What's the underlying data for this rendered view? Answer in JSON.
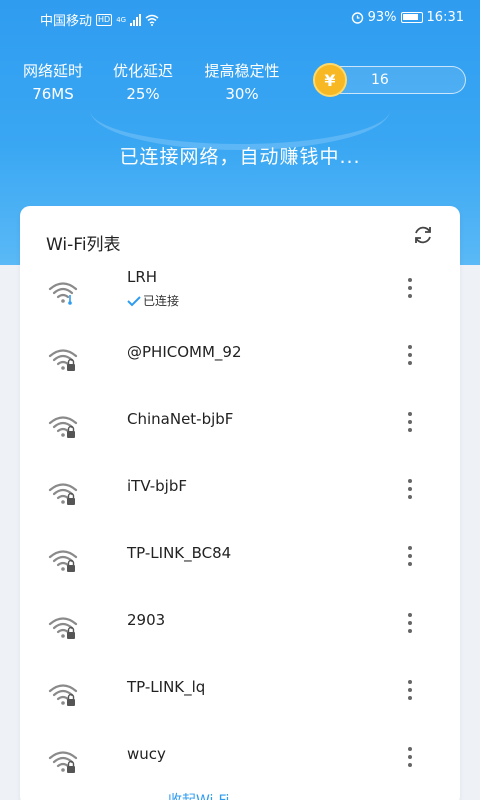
{
  "status_bar": {
    "carrier": "中国移动",
    "hd_badge": "HD",
    "network_type": "4G",
    "battery_percent": "93%",
    "time": "16:31"
  },
  "stats": [
    {
      "label": "网络延时",
      "value": "76MS"
    },
    {
      "label": "优化延迟",
      "value": "25%"
    },
    {
      "label": "提高稳定性",
      "value": "30%"
    }
  ],
  "coins": {
    "symbol": "¥",
    "count": "16"
  },
  "connect_message": "已连接网络，自动赚钱中...",
  "wifi_list": {
    "title": "Wi-Fi列表",
    "connected_label": "已连接",
    "networks": [
      {
        "name": "LRH",
        "connected": true,
        "locked": false
      },
      {
        "name": "@PHICOMM_92",
        "connected": false,
        "locked": true
      },
      {
        "name": "ChinaNet-bjbF",
        "connected": false,
        "locked": true
      },
      {
        "name": "iTV-bjbF",
        "connected": false,
        "locked": true
      },
      {
        "name": "TP-LINK_BC84",
        "connected": false,
        "locked": true
      },
      {
        "name": "2903",
        "connected": false,
        "locked": true
      },
      {
        "name": "TP-LINK_lq",
        "connected": false,
        "locked": true
      },
      {
        "name": "wucy",
        "connected": false,
        "locked": true
      }
    ]
  },
  "bottom_link": "收起Wi-Fi",
  "colors": {
    "primary": "#2f9cf0",
    "coin": "#f7b823",
    "text": "#222222"
  }
}
